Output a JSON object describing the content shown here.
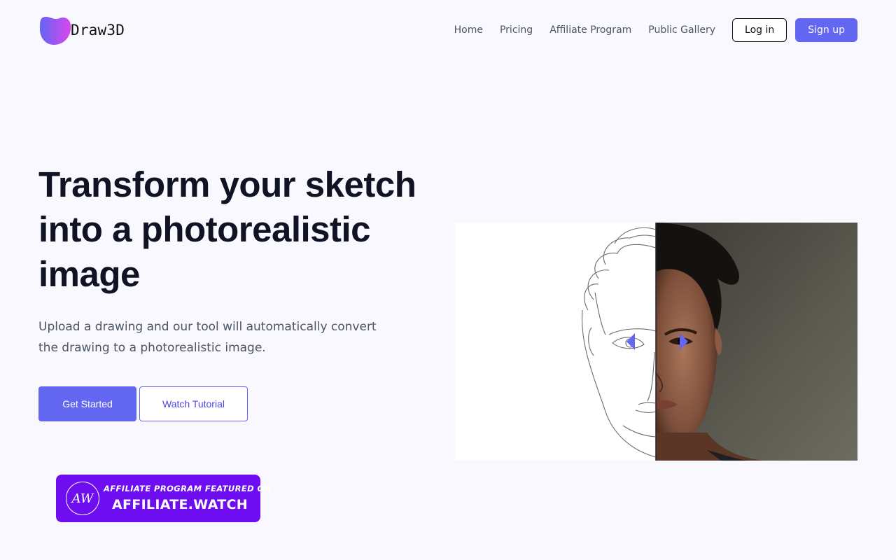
{
  "header": {
    "brand": "Draw3D",
    "nav": [
      {
        "label": "Home"
      },
      {
        "label": "Pricing"
      },
      {
        "label": "Affiliate Program"
      },
      {
        "label": "Public Gallery"
      }
    ],
    "login_label": "Log in",
    "signup_label": "Sign up"
  },
  "hero": {
    "title": "Transform your sketch into a photorealistic image",
    "subtitle": "Upload a drawing and our tool will automatically convert the drawing to a photorealistic image.",
    "primary_label": "Get Started",
    "secondary_label": "Watch Tutorial"
  },
  "badge": {
    "monogram": "AW",
    "top_text": "AFFILIATE PROGRAM FEATURED ON",
    "bottom_text": "AFFILIATE.WATCH"
  },
  "compare": {
    "slider_position": 0.5,
    "icons": [
      "chevron-left-icon",
      "chevron-right-icon"
    ]
  },
  "colors": {
    "accent": "#6366f1",
    "badge_bg": "#6d0df0",
    "page_bg": "#f9f8fe",
    "heading": "#0f1324"
  }
}
